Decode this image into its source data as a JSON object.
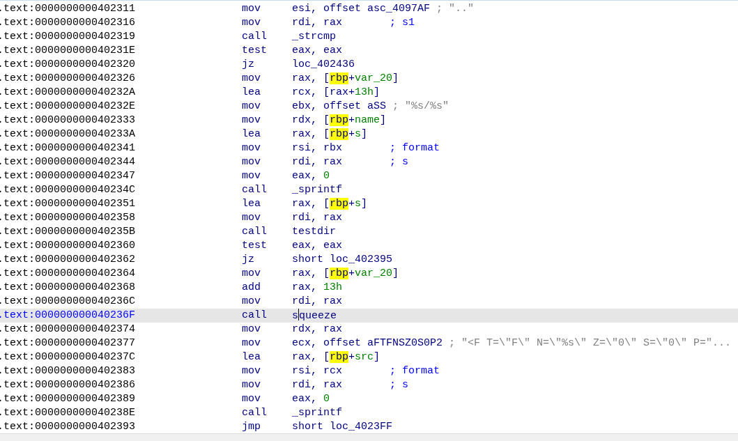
{
  "listing": {
    "rows": [
      {
        "address": ".text:0000000000402311",
        "selected": false,
        "mnemonic": "mov",
        "operands": [
          {
            "t": "esi, offset asc_4097AF",
            "kind": "op"
          }
        ],
        "comment": {
          "text": "; \"..\"",
          "kind": "string"
        }
      },
      {
        "address": ".text:0000000000402316",
        "selected": false,
        "mnemonic": "mov",
        "operands": [
          {
            "t": "rdi, rax",
            "kind": "op"
          }
        ],
        "comment": {
          "text": "; s1",
          "kind": "auto"
        }
      },
      {
        "address": ".text:0000000000402319",
        "selected": false,
        "mnemonic": "call",
        "operands": [
          {
            "t": "_strcmp",
            "kind": "op"
          }
        ]
      },
      {
        "address": ".text:000000000040231E",
        "selected": false,
        "mnemonic": "test",
        "operands": [
          {
            "t": "eax, eax",
            "kind": "op"
          }
        ]
      },
      {
        "address": ".text:0000000000402320",
        "selected": false,
        "mnemonic": "jz",
        "operands": [
          {
            "t": "loc_402436",
            "kind": "op"
          }
        ]
      },
      {
        "address": ".text:0000000000402326",
        "selected": false,
        "mnemonic": "mov",
        "operands": [
          {
            "t": "rax, [",
            "kind": "op"
          },
          {
            "t": "rbp",
            "kind": "hl"
          },
          {
            "t": "+",
            "kind": "op"
          },
          {
            "t": "var_20",
            "kind": "name"
          },
          {
            "t": "]",
            "kind": "op"
          }
        ]
      },
      {
        "address": ".text:000000000040232A",
        "selected": false,
        "mnemonic": "lea",
        "operands": [
          {
            "t": "rcx, [rax+",
            "kind": "op"
          },
          {
            "t": "13h",
            "kind": "name"
          },
          {
            "t": "]",
            "kind": "op"
          }
        ]
      },
      {
        "address": ".text:000000000040232E",
        "selected": false,
        "mnemonic": "mov",
        "operands": [
          {
            "t": "ebx, offset aSS",
            "kind": "op"
          }
        ],
        "comment": {
          "text": "; \"%s/%s\"",
          "kind": "string"
        }
      },
      {
        "address": ".text:0000000000402333",
        "selected": false,
        "mnemonic": "mov",
        "operands": [
          {
            "t": "rdx, [",
            "kind": "op"
          },
          {
            "t": "rbp",
            "kind": "hl"
          },
          {
            "t": "+",
            "kind": "op"
          },
          {
            "t": "name",
            "kind": "name"
          },
          {
            "t": "]",
            "kind": "op"
          }
        ]
      },
      {
        "address": ".text:000000000040233A",
        "selected": false,
        "mnemonic": "lea",
        "operands": [
          {
            "t": "rax, [",
            "kind": "op"
          },
          {
            "t": "rbp",
            "kind": "hl"
          },
          {
            "t": "+",
            "kind": "op"
          },
          {
            "t": "s",
            "kind": "name"
          },
          {
            "t": "]",
            "kind": "op"
          }
        ]
      },
      {
        "address": ".text:0000000000402341",
        "selected": false,
        "mnemonic": "mov",
        "operands": [
          {
            "t": "rsi, rbx",
            "kind": "op"
          }
        ],
        "comment": {
          "text": "; format",
          "kind": "auto"
        }
      },
      {
        "address": ".text:0000000000402344",
        "selected": false,
        "mnemonic": "mov",
        "operands": [
          {
            "t": "rdi, rax",
            "kind": "op"
          }
        ],
        "comment": {
          "text": "; s",
          "kind": "auto"
        }
      },
      {
        "address": ".text:0000000000402347",
        "selected": false,
        "mnemonic": "mov",
        "operands": [
          {
            "t": "eax, ",
            "kind": "op"
          },
          {
            "t": "0",
            "kind": "name"
          }
        ]
      },
      {
        "address": ".text:000000000040234C",
        "selected": false,
        "mnemonic": "call",
        "operands": [
          {
            "t": "_sprintf",
            "kind": "op"
          }
        ]
      },
      {
        "address": ".text:0000000000402351",
        "selected": false,
        "mnemonic": "lea",
        "operands": [
          {
            "t": "rax, [",
            "kind": "op"
          },
          {
            "t": "rbp",
            "kind": "hl"
          },
          {
            "t": "+",
            "kind": "op"
          },
          {
            "t": "s",
            "kind": "name"
          },
          {
            "t": "]",
            "kind": "op"
          }
        ]
      },
      {
        "address": ".text:0000000000402358",
        "selected": false,
        "mnemonic": "mov",
        "operands": [
          {
            "t": "rdi, rax",
            "kind": "op"
          }
        ]
      },
      {
        "address": ".text:000000000040235B",
        "selected": false,
        "mnemonic": "call",
        "operands": [
          {
            "t": "testdir",
            "kind": "op"
          }
        ]
      },
      {
        "address": ".text:0000000000402360",
        "selected": false,
        "mnemonic": "test",
        "operands": [
          {
            "t": "eax, eax",
            "kind": "op"
          }
        ]
      },
      {
        "address": ".text:0000000000402362",
        "selected": false,
        "mnemonic": "jz",
        "operands": [
          {
            "t": "short loc_402395",
            "kind": "op"
          }
        ]
      },
      {
        "address": ".text:0000000000402364",
        "selected": false,
        "mnemonic": "mov",
        "operands": [
          {
            "t": "rax, [",
            "kind": "op"
          },
          {
            "t": "rbp",
            "kind": "hl"
          },
          {
            "t": "+",
            "kind": "op"
          },
          {
            "t": "var_20",
            "kind": "name"
          },
          {
            "t": "]",
            "kind": "op"
          }
        ]
      },
      {
        "address": ".text:0000000000402368",
        "selected": false,
        "mnemonic": "add",
        "operands": [
          {
            "t": "rax, ",
            "kind": "op"
          },
          {
            "t": "13h",
            "kind": "name"
          }
        ]
      },
      {
        "address": ".text:000000000040236C",
        "selected": false,
        "mnemonic": "mov",
        "operands": [
          {
            "t": "rdi, rax",
            "kind": "op"
          }
        ]
      },
      {
        "address": ".text:000000000040236F",
        "selected": true,
        "mnemonic": "call",
        "operands": [
          {
            "t": "s",
            "kind": "op"
          },
          {
            "kind": "cursor"
          },
          {
            "t": "queeze",
            "kind": "op"
          }
        ]
      },
      {
        "address": ".text:0000000000402374",
        "selected": false,
        "mnemonic": "mov",
        "operands": [
          {
            "t": "rdx, rax",
            "kind": "op"
          }
        ]
      },
      {
        "address": ".text:0000000000402377",
        "selected": false,
        "mnemonic": "mov",
        "operands": [
          {
            "t": "ecx, offset aFTFNSZ0S0P2",
            "kind": "op"
          }
        ],
        "comment": {
          "text": "; \"<F T=\\\"F\\\" N=\\\"%s\\\" Z=\\\"0\\\" S=\\\"0\\\" P=\"...",
          "kind": "string"
        }
      },
      {
        "address": ".text:000000000040237C",
        "selected": false,
        "mnemonic": "lea",
        "operands": [
          {
            "t": "rax, [",
            "kind": "op"
          },
          {
            "t": "rbp",
            "kind": "hl"
          },
          {
            "t": "+",
            "kind": "op"
          },
          {
            "t": "src",
            "kind": "name"
          },
          {
            "t": "]",
            "kind": "op"
          }
        ]
      },
      {
        "address": ".text:0000000000402383",
        "selected": false,
        "mnemonic": "mov",
        "operands": [
          {
            "t": "rsi, rcx",
            "kind": "op"
          }
        ],
        "comment": {
          "text": "; format",
          "kind": "auto"
        }
      },
      {
        "address": ".text:0000000000402386",
        "selected": false,
        "mnemonic": "mov",
        "operands": [
          {
            "t": "rdi, rax",
            "kind": "op"
          }
        ],
        "comment": {
          "text": "; s",
          "kind": "auto"
        }
      },
      {
        "address": ".text:0000000000402389",
        "selected": false,
        "mnemonic": "mov",
        "operands": [
          {
            "t": "eax, ",
            "kind": "op"
          },
          {
            "t": "0",
            "kind": "name"
          }
        ]
      },
      {
        "address": ".text:000000000040238E",
        "selected": false,
        "mnemonic": "call",
        "operands": [
          {
            "t": "_sprintf",
            "kind": "op"
          }
        ]
      },
      {
        "address": ".text:0000000000402393",
        "selected": false,
        "mnemonic": "jmp",
        "operands": [
          {
            "t": "short loc_4023FF",
            "kind": "op"
          }
        ]
      }
    ]
  }
}
